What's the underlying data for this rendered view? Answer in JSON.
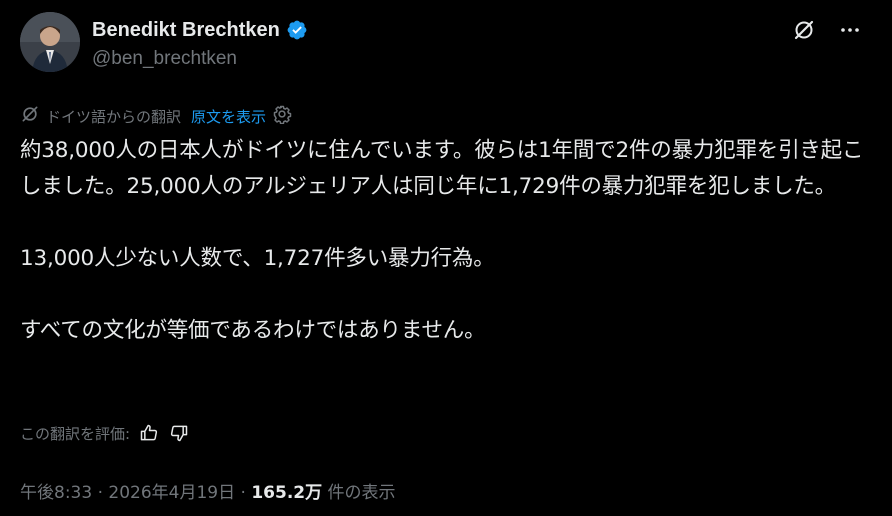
{
  "author": {
    "display_name": "Benedikt Brechtken",
    "handle": "@ben_brechtken",
    "verified": true,
    "badge_color": "#1d9bf0"
  },
  "translation": {
    "notice": "ドイツ語からの翻訳",
    "show_original": "原文を表示"
  },
  "tweet": {
    "paragraphs": [
      "約38,000人の日本人がドイツに住んでいます。彼らは1年間で2件の暴力犯罪を引き起こしました。25,000人のアルジェリア人は同じ年に1,729件の暴力犯罪を犯しました。",
      "13,000人少ない人数で、1,727件多い暴力行為。",
      "すべての文化が等価であるわけではありません。"
    ]
  },
  "rating": {
    "label": "この翻訳を評価:"
  },
  "meta": {
    "time": "午後8:33",
    "sep1": "·",
    "date": "2026年4月19日",
    "sep2": "·",
    "views": "165.2万",
    "views_label": "件の表示"
  },
  "icons": {
    "grok": "grok-icon",
    "more": "more-icon",
    "translate": "translate-icon",
    "settings": "gear-icon",
    "thumbs_up": "thumbs-up-icon",
    "thumbs_down": "thumbs-down-icon"
  },
  "colors": {
    "background": "#000000",
    "text": "#e7e9ea",
    "muted": "#71767b",
    "link": "#1d9bf0"
  }
}
